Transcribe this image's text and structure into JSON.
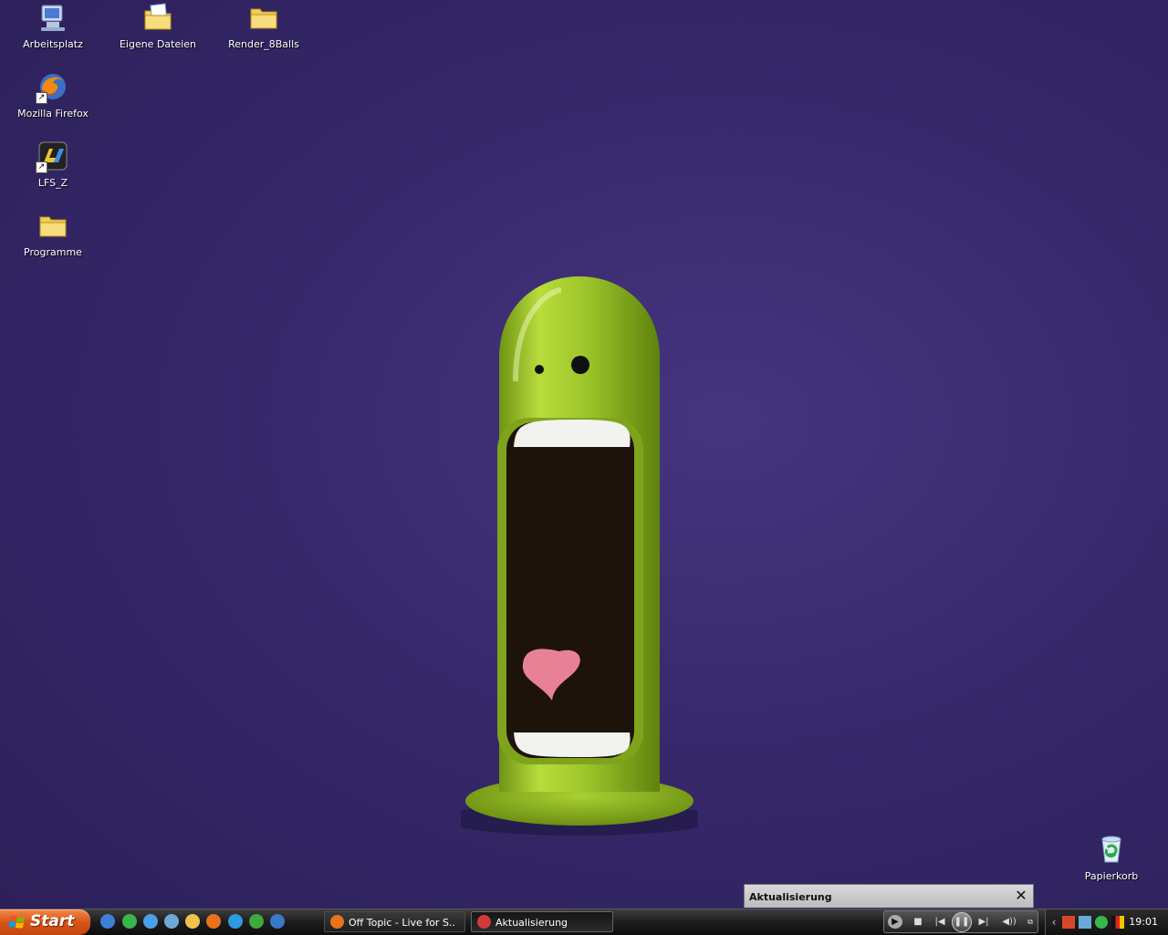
{
  "desktop": {
    "icons": [
      {
        "label": "Arbeitsplatz"
      },
      {
        "label": "Eigene Dateien"
      },
      {
        "label": "Render_8Balls"
      },
      {
        "label": "Mozilla Firefox"
      },
      {
        "label": "LFS_Z"
      },
      {
        "label": "Programme"
      },
      {
        "label": "Papierkorb"
      }
    ]
  },
  "notification": {
    "title": "Aktualisierung",
    "close_symbol": "✕"
  },
  "taskbar": {
    "start_label": "Start",
    "quick_launch": [
      "ie-icon",
      "messenger-icon",
      "internet-explorer-icon",
      "itunes-icon",
      "mail-icon",
      "firefox-icon",
      "search-icon",
      "msn-icon",
      "media-player-icon"
    ],
    "tasks": [
      {
        "label": "Off Topic - Live for S..."
      },
      {
        "label": "Aktualisierung"
      }
    ],
    "player": {
      "stop": "■",
      "prev": "|◀",
      "pause": "❚❚",
      "next": "▶|",
      "volume": "◀))"
    },
    "tray": {
      "time": "19:01",
      "expand": "‹"
    }
  },
  "colors": {
    "desktop": "#37286b",
    "monster": "#9cc42a",
    "start": "#d85518"
  }
}
